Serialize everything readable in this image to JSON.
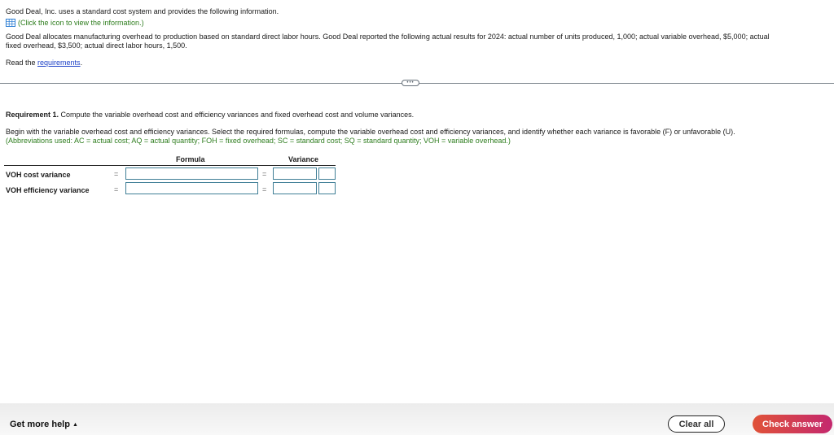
{
  "intro": {
    "line1": "Good Deal, Inc. uses a standard cost system and provides the following information.",
    "info_link": "(Click the icon to view the information.)",
    "line3": "Good Deal allocates manufacturing overhead to production based on standard direct labor hours. Good Deal reported the following actual results for 2024: actual number of units produced, 1,000; actual variable overhead, $5,000; actual",
    "line4": "fixed overhead, $3,500; actual direct labor hours, 1,500.",
    "read_prefix": "Read the ",
    "read_link": "requirements",
    "read_suffix": "."
  },
  "divider": {
    "handle_label": "•••"
  },
  "requirement": {
    "label": "Requirement 1.",
    "text": " Compute the variable overhead cost and efficiency variances and fixed overhead cost and volume variances.",
    "instructions": "Begin with the variable overhead cost and efficiency variances. Select the required formulas, compute the variable overhead cost and efficiency variances, and identify whether each variance is favorable (F) or unfavorable (U).",
    "abbreviations": "(Abbreviations used: AC = actual cost; AQ = actual quantity; FOH = fixed overhead; SC = standard cost; SQ = standard quantity; VOH = variable overhead.)"
  },
  "table": {
    "headers": {
      "formula": "Formula",
      "variance": "Variance"
    },
    "rows": [
      {
        "label": "VOH cost variance",
        "eq1": "=",
        "formula": "",
        "eq2": "=",
        "variance": "",
        "fu": ""
      },
      {
        "label": "VOH efficiency variance",
        "eq1": "=",
        "formula": "",
        "eq2": "=",
        "variance": "",
        "fu": ""
      }
    ]
  },
  "footer": {
    "help_label": "Get more help",
    "help_arrow": "▲",
    "clear_label": "Clear all",
    "check_label": "Check answer"
  }
}
